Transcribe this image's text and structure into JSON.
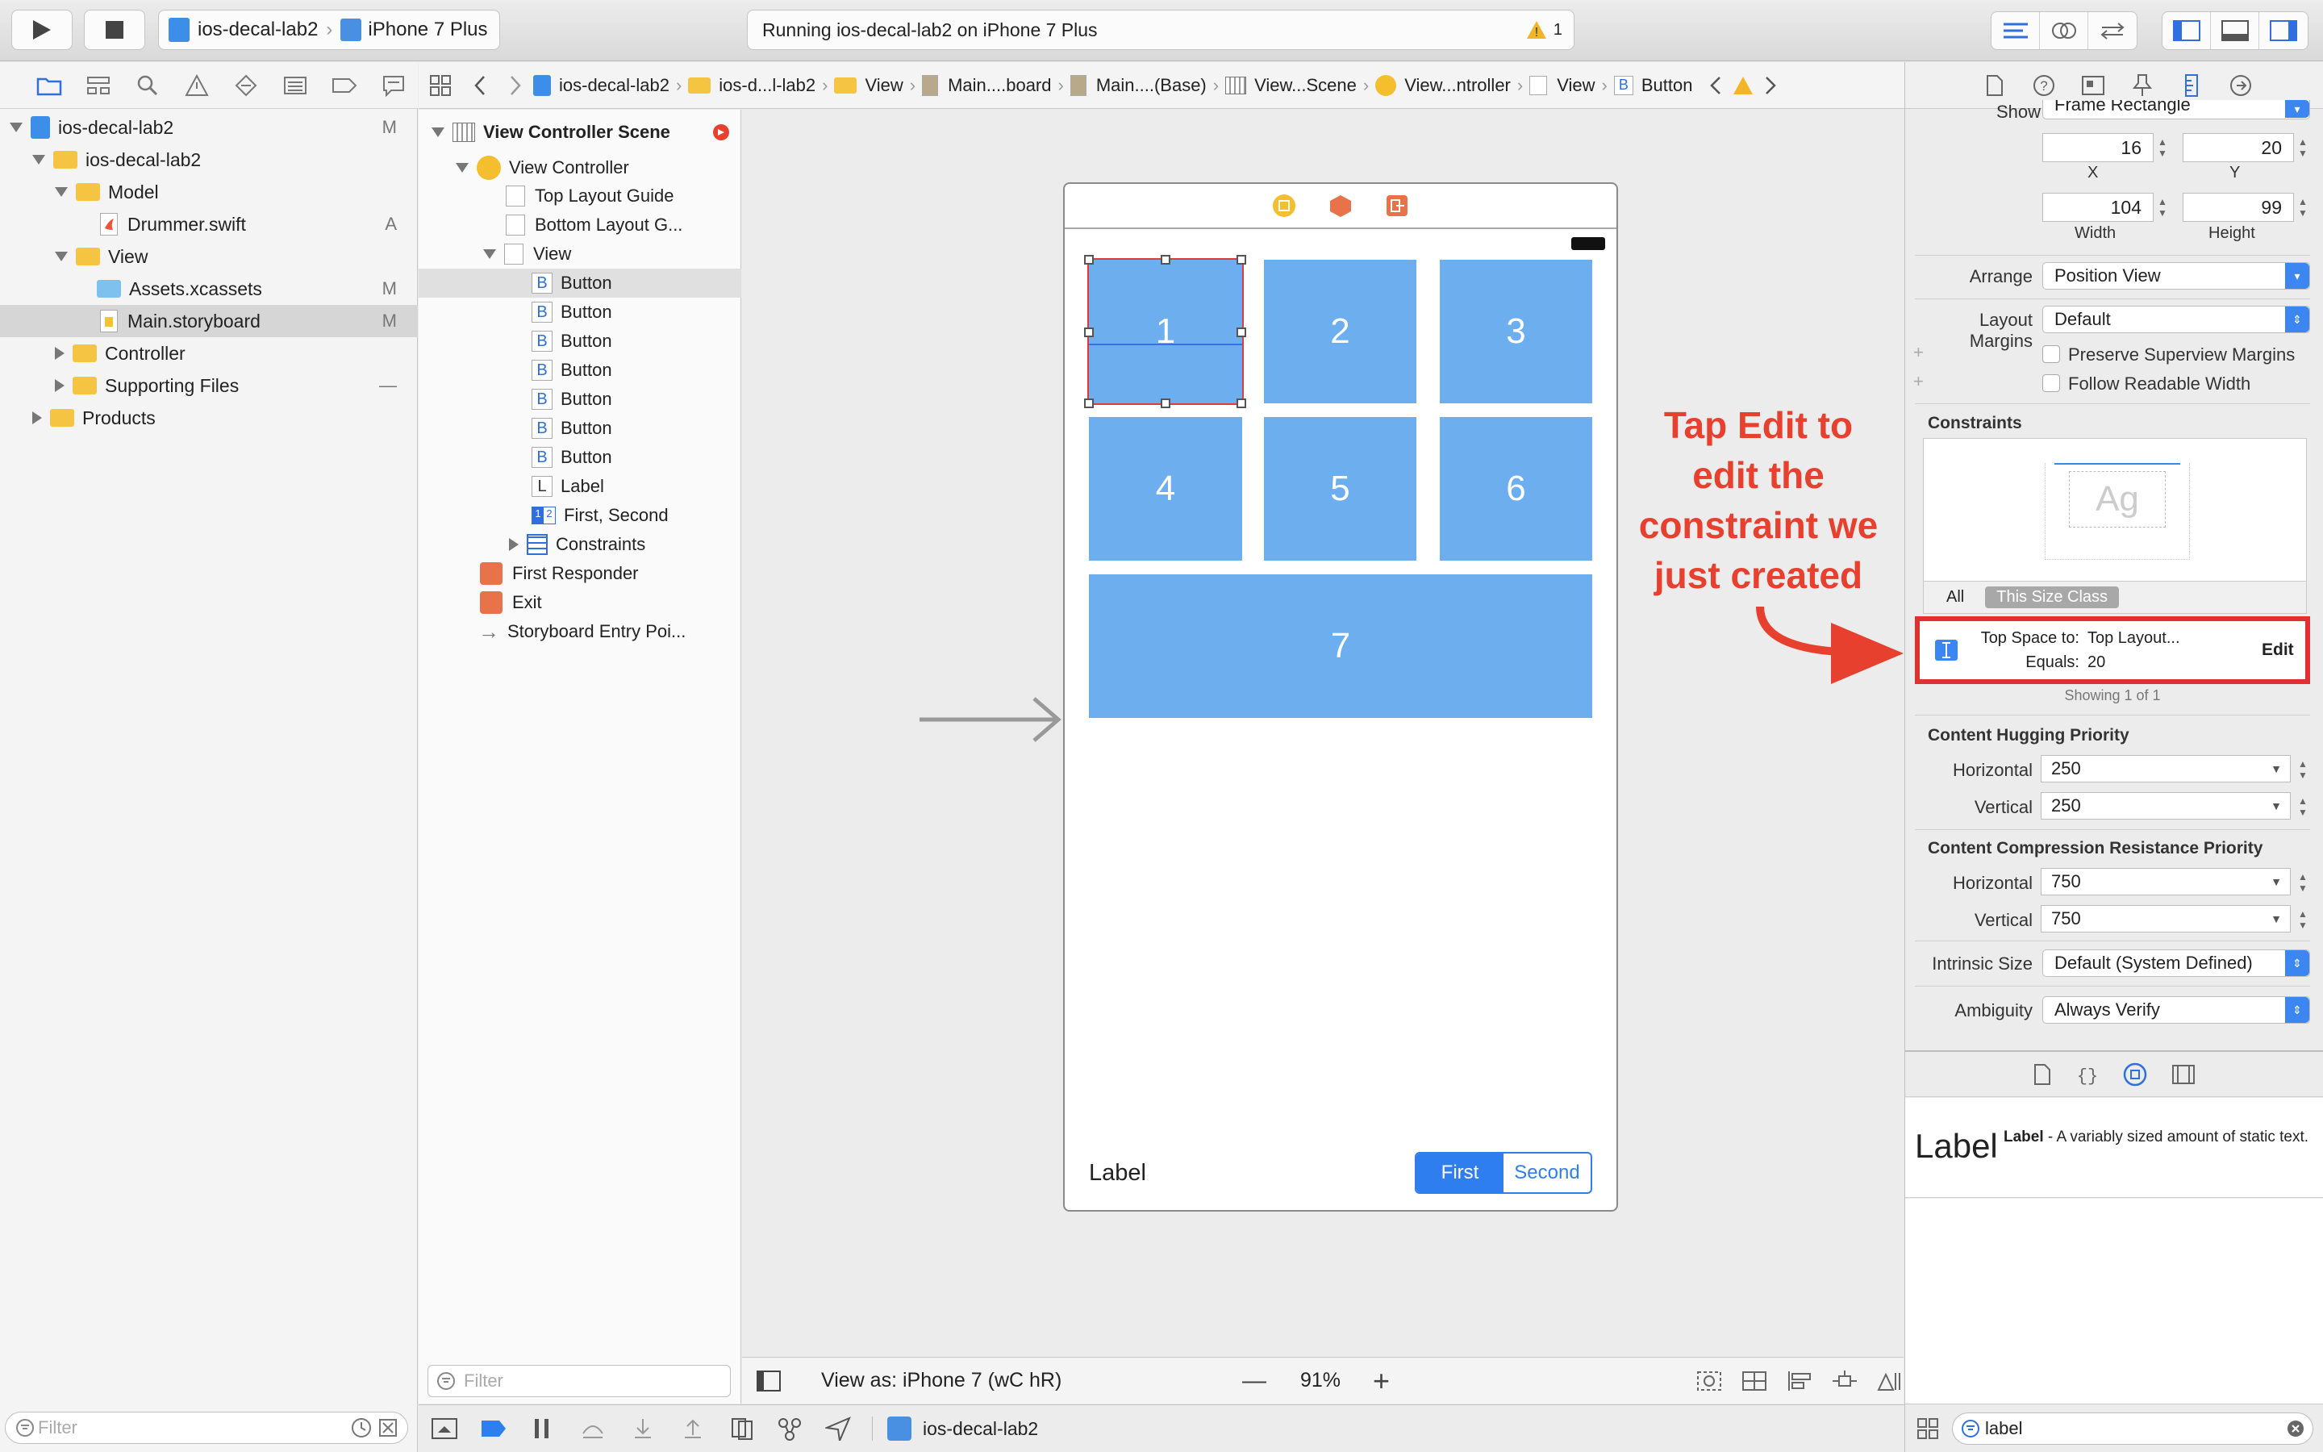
{
  "toolbar": {
    "scheme_project": "ios-decal-lab2",
    "scheme_device": "iPhone 7 Plus",
    "activity_text": "Running ios-decal-lab2 on iPhone 7 Plus",
    "warning_count": "1"
  },
  "navigator": {
    "items": [
      {
        "label": "ios-decal-lab2",
        "badge": "M"
      },
      {
        "label": "ios-decal-lab2",
        "badge": ""
      },
      {
        "label": "Model",
        "badge": ""
      },
      {
        "label": "Drummer.swift",
        "badge": "A"
      },
      {
        "label": "View",
        "badge": ""
      },
      {
        "label": "Assets.xcassets",
        "badge": "M"
      },
      {
        "label": "Main.storyboard",
        "badge": "M"
      },
      {
        "label": "Controller",
        "badge": ""
      },
      {
        "label": "Supporting Files",
        "badge": "—"
      },
      {
        "label": "Products",
        "badge": ""
      }
    ],
    "filter_placeholder": "Filter"
  },
  "jumpbar": {
    "crumbs": [
      "ios-decal-lab2",
      "ios-d...l-lab2",
      "View",
      "Main....board",
      "Main....(Base)",
      "View...Scene",
      "View...ntroller",
      "View",
      "Button"
    ]
  },
  "outline": {
    "scene_title": "View Controller Scene",
    "rows": [
      "View Controller",
      "Top Layout Guide",
      "Bottom Layout G...",
      "View",
      "Button",
      "Button",
      "Button",
      "Button",
      "Button",
      "Button",
      "Button",
      "Label",
      "First, Second",
      "Constraints",
      "First Responder",
      "Exit",
      "Storyboard Entry Poi..."
    ],
    "filter_placeholder": "Filter"
  },
  "canvas": {
    "cells": [
      "1",
      "2",
      "3",
      "4",
      "5",
      "6",
      "7"
    ],
    "label_text": "Label",
    "segment_first": "First",
    "segment_second": "Second",
    "view_as": "View as: iPhone 7 (wC hR)",
    "zoom": "91%"
  },
  "annotation": {
    "lines": [
      "Tap Edit to",
      "edit the",
      "constraint we",
      "just created"
    ],
    "color": "#e8402e"
  },
  "inspector": {
    "show_label": "Show",
    "show_value": "Frame Rectangle",
    "x_value": "16",
    "y_value": "20",
    "width_value": "104",
    "height_value": "99",
    "x_label": "X",
    "y_label": "Y",
    "width_label": "Width",
    "height_label": "Height",
    "arrange_label": "Arrange",
    "arrange_value": "Position View",
    "layout_margins_label": "Layout Margins",
    "layout_margins_value": "Default",
    "preserve_superview": "Preserve Superview Margins",
    "follow_readable": "Follow Readable Width",
    "constraints_title": "Constraints",
    "constraints_preview": "Ag",
    "scope_all": "All",
    "scope_size_class": "This Size Class",
    "constraint_top_space_label": "Top Space to:",
    "constraint_top_space_value": "Top Layout...",
    "constraint_equals_label": "Equals:",
    "constraint_equals_value": "20",
    "constraint_edit": "Edit",
    "showing": "Showing 1 of 1",
    "hugging_title": "Content Hugging Priority",
    "hugging_horizontal_label": "Horizontal",
    "hugging_horizontal": "250",
    "hugging_vertical_label": "Vertical",
    "hugging_vertical": "250",
    "compression_title": "Content Compression Resistance Priority",
    "compression_horizontal_label": "Horizontal",
    "compression_horizontal": "750",
    "compression_vertical_label": "Vertical",
    "compression_vertical": "750",
    "intrinsic_label": "Intrinsic Size",
    "intrinsic_value": "Default (System Defined)",
    "ambiguity_label": "Ambiguity",
    "ambiguity_value": "Always Verify"
  },
  "library": {
    "item_big": "Label",
    "item_title": "Label",
    "item_desc": " - A variably sized amount of static text.",
    "search_value": "label"
  },
  "debugbar": {
    "target": "ios-decal-lab2"
  }
}
